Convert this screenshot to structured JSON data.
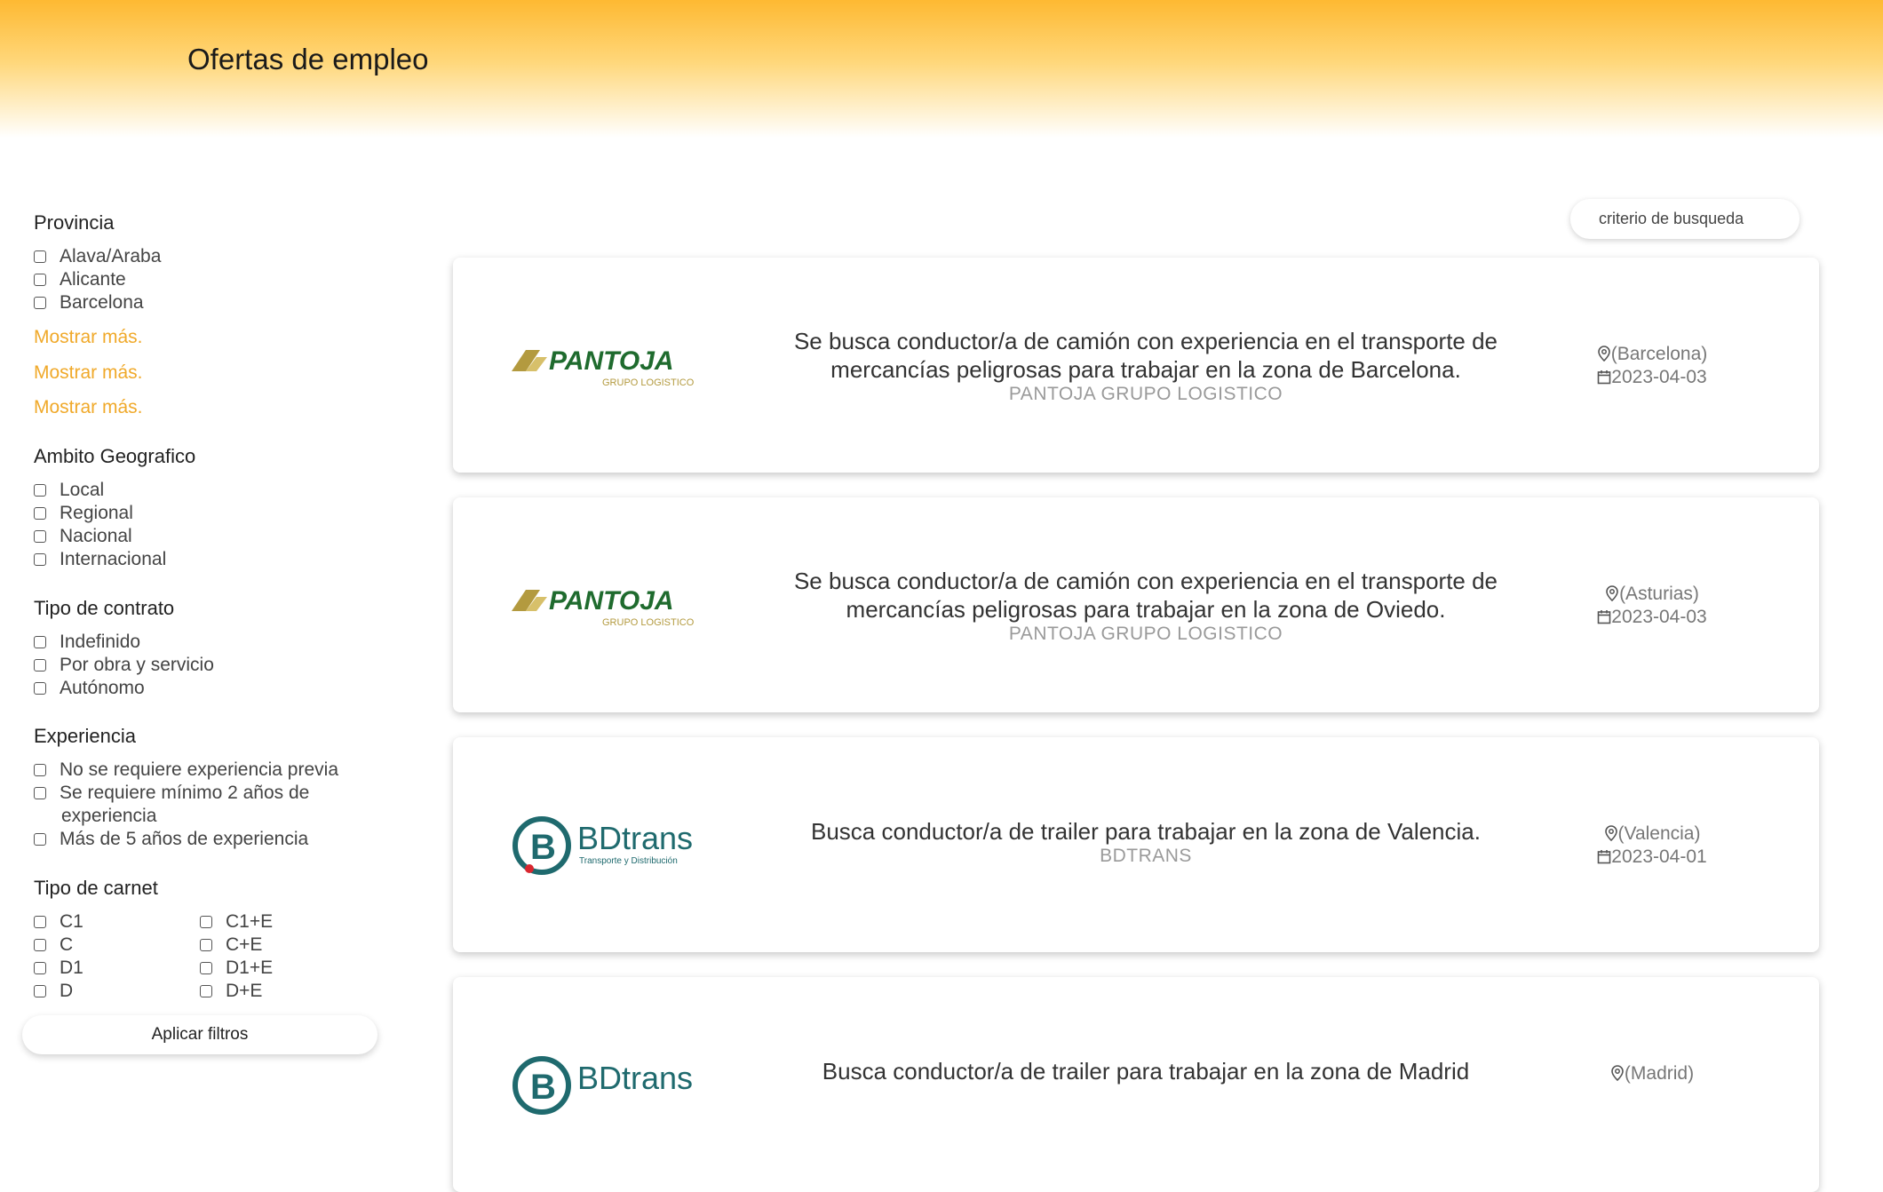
{
  "header": {
    "title": "Ofertas de empleo"
  },
  "filters": {
    "provincia": {
      "title": "Provincia",
      "options": [
        "Alava/Araba",
        "Alicante",
        "Barcelona"
      ],
      "more_links": [
        "Mostrar más.",
        "Mostrar más.",
        "Mostrar más."
      ]
    },
    "ambito": {
      "title": "Ambito Geografico",
      "options": [
        "Local",
        "Regional",
        "Nacional",
        "Internacional"
      ]
    },
    "contrato": {
      "title": "Tipo de contrato",
      "options": [
        "Indefinido",
        "Por obra y servicio",
        "Autónomo"
      ]
    },
    "experiencia": {
      "title": "Experiencia",
      "options": [
        "No se requiere experiencia previa",
        "Se requiere mínimo 2 años de",
        "experiencia",
        "Más de 5 años de experiencia"
      ]
    },
    "carnet": {
      "title": "Tipo de carnet",
      "col1": [
        "C1",
        "C",
        "D1",
        "D"
      ],
      "col2": [
        "C1+E",
        "C+E",
        "D1+E",
        "D+E"
      ]
    },
    "apply_label": "Aplicar filtros"
  },
  "search": {
    "placeholder": "criterio de busqueda"
  },
  "jobs": [
    {
      "logo": "pantoja-logo",
      "logo_text": "PANTOJA",
      "logo_sub": "GRUPO LOGISTICO",
      "title_l1": "Se busca conductor/a de camión con experiencia en el transporte de",
      "title_l2": "mercancías peligrosas para trabajar en la zona de Barcelona.",
      "company": "PANTOJA GRUPO LOGISTICO",
      "location": "(Barcelona)",
      "date": "2023-04-03"
    },
    {
      "logo": "pantoja-logo",
      "logo_text": "PANTOJA",
      "logo_sub": "GRUPO LOGISTICO",
      "title_l1": "Se busca conductor/a de camión con experiencia en el transporte de",
      "title_l2": "mercancías peligrosas para trabajar en la zona de Oviedo.",
      "company": "PANTOJA GRUPO LOGISTICO",
      "location": "(Asturias)",
      "date": "2023-04-03"
    },
    {
      "logo": "bdtrans-logo",
      "logo_text": "BDtrans",
      "logo_sub": "Transporte y Distribución",
      "title_l1": "Busca conductor/a de trailer para trabajar en la zona de Valencia.",
      "company": "BDTRANS",
      "location": "(Valencia)",
      "date": "2023-04-01"
    },
    {
      "logo": "bdtrans-logo",
      "logo_text": "BDtrans",
      "title_l1": "Busca conductor/a de trailer para trabajar en la zona de Madrid",
      "location": "(Madrid)"
    }
  ],
  "colors": {
    "header_top": "#feb932",
    "link": "#f0a92a",
    "pantoja_gold": "#b39a3f",
    "pantoja_green": "#1f6b2e",
    "bdtrans_teal": "#1f6a6e"
  }
}
